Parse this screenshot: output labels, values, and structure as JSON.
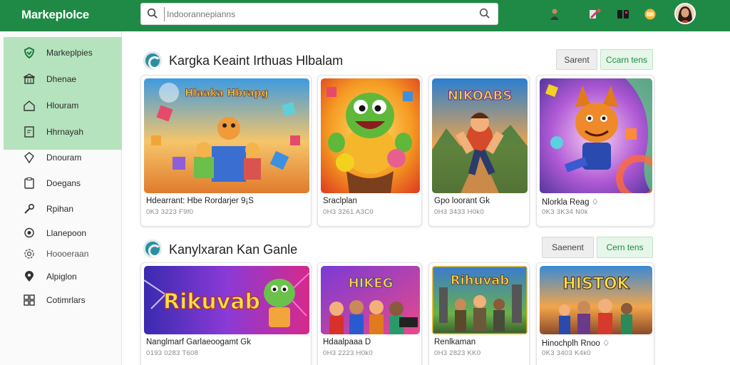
{
  "app": {
    "brand": "Markeplolce",
    "search": {
      "placeholder": "Indoorannepianns"
    }
  },
  "colors": {
    "brand_green": "#1f8a46",
    "sidebar_active": "#b5e3bd"
  },
  "header_icons": [
    "user-icon",
    "tools-icon",
    "device-icon",
    "coin-icon",
    "avatar"
  ],
  "sidebar": {
    "items": [
      {
        "label": "Markeplpies",
        "icon": "shield-icon"
      },
      {
        "label": "Dhenae",
        "icon": "bank-icon"
      },
      {
        "label": "Hlouram",
        "icon": "home-icon"
      },
      {
        "label": "Hhrnayah",
        "icon": "document-icon"
      },
      {
        "label": "Dnouram",
        "icon": "tag-icon"
      },
      {
        "label": "Doegans",
        "icon": "clipboard-icon"
      },
      {
        "label": "Rpihan",
        "icon": "wrench-icon"
      },
      {
        "label": "Llanepoon",
        "icon": "chat-icon"
      },
      {
        "label": "Hoooeraan",
        "icon": "gear-icon"
      },
      {
        "label": "Alpiglon",
        "icon": "location-icon"
      },
      {
        "label": "Cotimrlars",
        "icon": "apps-icon"
      }
    ]
  },
  "sections": [
    {
      "title": "Kargka Keaint Irthuas Hlbalam",
      "button_secondary": "Sarent",
      "button_primary": "Ccarn tens",
      "cards": [
        {
          "title": "Hdearrant: Hbe Rordarjer 9¡S",
          "meta": "0K3 3223 F9f0",
          "thumb_title": "Hlaaka Hbrapg"
        },
        {
          "title": "Sraclplan",
          "meta": "0H3 3261 A3C0",
          "thumb_title": ""
        },
        {
          "title": "Gpo loorant Gk",
          "meta": "0H3 3433 H0k0",
          "thumb_title": "NIKOABS"
        },
        {
          "title": "Nlorkla Reag ♢",
          "meta": "0K3 3K34 N0k",
          "thumb_title": ""
        }
      ]
    },
    {
      "title": "Kanylxaran Kan Ganle",
      "button_secondary": "Saenent",
      "button_primary": "Cern tens",
      "cards": [
        {
          "title": "Nanglmarf Garlaeoogamt Gk",
          "meta": "0193 0283 T608",
          "thumb_title": "Rikuvab"
        },
        {
          "title": "Hdaalpaaa D",
          "meta": "0H3 2223 H0k0",
          "thumb_title": "HIKEG"
        },
        {
          "title": "Renlkaman",
          "meta": "0H3 2823 KK0",
          "thumb_title": "Rihuvab"
        },
        {
          "title": "Hinochplh Rnoo ♢",
          "meta": "0K3 3403 K4k0",
          "thumb_title": "HISTOK"
        }
      ]
    }
  ]
}
